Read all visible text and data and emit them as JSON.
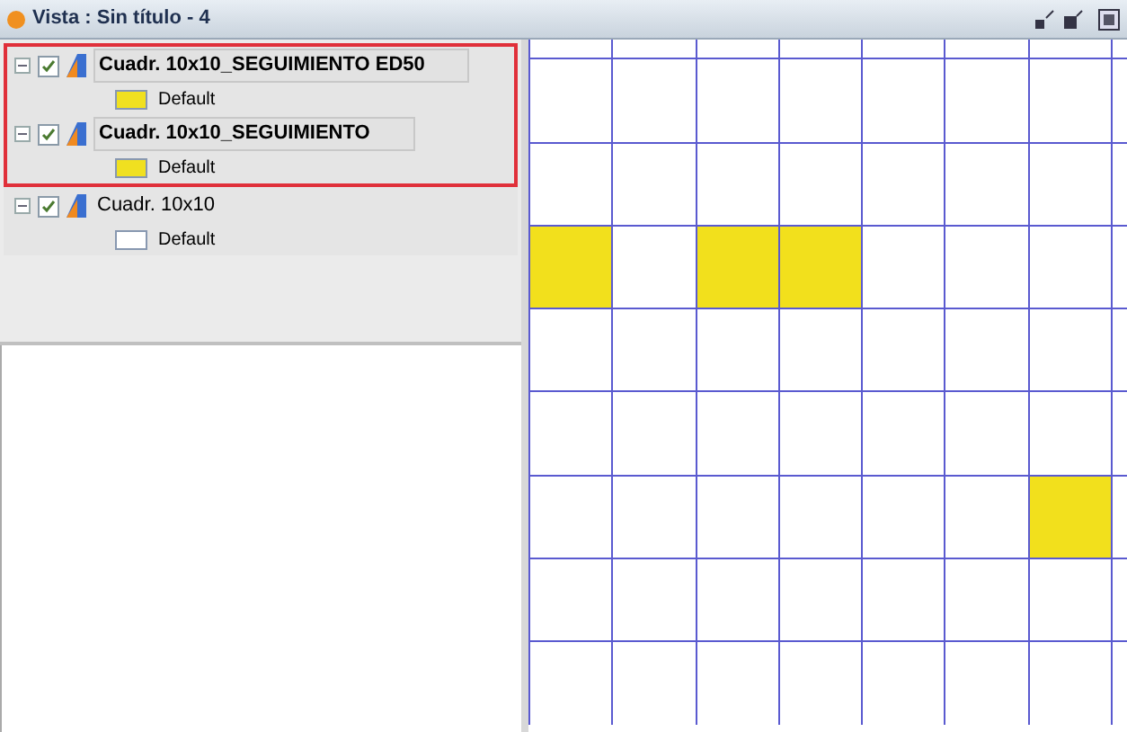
{
  "window": {
    "title": "Vista : Sin título - 4"
  },
  "layers": [
    {
      "name": "Cuadr. 10x10_SEGUIMIENTO ED50",
      "checked": true,
      "active": true,
      "highlighted": true,
      "legend": {
        "label": "Default",
        "color": "#f0e020"
      }
    },
    {
      "name": "Cuadr. 10x10_SEGUIMIENTO",
      "checked": true,
      "active": true,
      "highlighted": true,
      "legend": {
        "label": "Default",
        "color": "#f0e020"
      }
    },
    {
      "name": "Cuadr. 10x10",
      "checked": true,
      "active": false,
      "highlighted": false,
      "legend": {
        "label": "Default",
        "color": "#ffffff"
      }
    }
  ],
  "map": {
    "rows": [
      [
        {
          "filled": false
        },
        {
          "filled": false
        },
        {
          "filled": false
        },
        {
          "filled": false
        },
        {
          "filled": false
        },
        {
          "filled": false
        },
        {
          "filled": false
        },
        {
          "filled": false
        }
      ],
      [
        {
          "filled": false
        },
        {
          "filled": false
        },
        {
          "filled": false
        },
        {
          "filled": false
        },
        {
          "filled": false
        },
        {
          "filled": false
        },
        {
          "filled": false
        },
        {
          "filled": false
        }
      ],
      [
        {
          "filled": false
        },
        {
          "filled": false
        },
        {
          "filled": false
        },
        {
          "filled": false
        },
        {
          "filled": false
        },
        {
          "filled": false
        },
        {
          "filled": false
        },
        {
          "filled": false
        }
      ],
      [
        {
          "filled": true
        },
        {
          "filled": false
        },
        {
          "filled": true
        },
        {
          "filled": true
        },
        {
          "filled": false
        },
        {
          "filled": false
        },
        {
          "filled": false
        },
        {
          "filled": false
        }
      ],
      [
        {
          "filled": false
        },
        {
          "filled": false
        },
        {
          "filled": false
        },
        {
          "filled": false
        },
        {
          "filled": false
        },
        {
          "filled": false
        },
        {
          "filled": false
        },
        {
          "filled": false
        }
      ],
      [
        {
          "filled": false
        },
        {
          "filled": false
        },
        {
          "filled": false
        },
        {
          "filled": false
        },
        {
          "filled": false
        },
        {
          "filled": false
        },
        {
          "filled": false
        },
        {
          "filled": false
        }
      ],
      [
        {
          "filled": false
        },
        {
          "filled": false
        },
        {
          "filled": false
        },
        {
          "filled": false
        },
        {
          "filled": false
        },
        {
          "filled": false
        },
        {
          "filled": true
        },
        {
          "filled": false
        }
      ],
      [
        {
          "filled": false
        },
        {
          "filled": false
        },
        {
          "filled": false
        },
        {
          "filled": false
        },
        {
          "filled": false
        },
        {
          "filled": false
        },
        {
          "filled": false
        },
        {
          "filled": false
        }
      ],
      [
        {
          "filled": false
        },
        {
          "filled": false
        },
        {
          "filled": false
        },
        {
          "filled": false
        },
        {
          "filled": false
        },
        {
          "filled": false
        },
        {
          "filled": false
        },
        {
          "filled": false
        }
      ]
    ]
  }
}
